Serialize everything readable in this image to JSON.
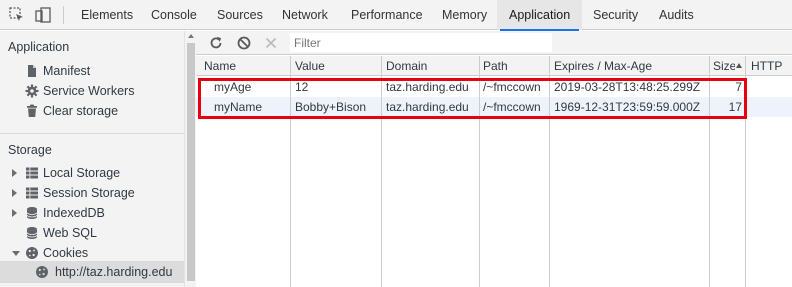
{
  "tabs": [
    "Elements",
    "Console",
    "Sources",
    "Network",
    "Performance",
    "Memory",
    "Application",
    "Security",
    "Audits"
  ],
  "active_tab": "Application",
  "sidebar": {
    "application_header": "Application",
    "application_items": [
      {
        "label": "Manifest",
        "icon": "document-icon"
      },
      {
        "label": "Service Workers",
        "icon": "gear-icon"
      },
      {
        "label": "Clear storage",
        "icon": "trash-icon"
      }
    ],
    "storage_header": "Storage",
    "storage_items": [
      {
        "label": "Local Storage",
        "icon": "grid-icon",
        "expand": "collapsed"
      },
      {
        "label": "Session Storage",
        "icon": "grid-icon",
        "expand": "collapsed"
      },
      {
        "label": "IndexedDB",
        "icon": "database-icon",
        "expand": "collapsed"
      },
      {
        "label": "Web SQL",
        "icon": "database-icon",
        "expand": "none"
      },
      {
        "label": "Cookies",
        "icon": "cookie-icon",
        "expand": "expanded"
      }
    ],
    "cookie_origin": "http://taz.harding.edu"
  },
  "toolbar": {
    "filter_placeholder": "Filter"
  },
  "table": {
    "columns": [
      "Name",
      "Value",
      "Domain",
      "Path",
      "Expires / Max-Age",
      "Size",
      "HTTP"
    ],
    "rows": [
      [
        "myAge",
        "12",
        "taz.harding.edu",
        "/~fmccown",
        "2019-03-28T13:48:25.299Z",
        "7",
        ""
      ],
      [
        "myName",
        "Bobby+Bison",
        "taz.harding.edu",
        "/~fmccown",
        "1969-12-31T23:59:59.000Z",
        "17",
        ""
      ]
    ]
  },
  "colors": {
    "accent": "#1a73e8",
    "highlight_border": "#e60012"
  }
}
